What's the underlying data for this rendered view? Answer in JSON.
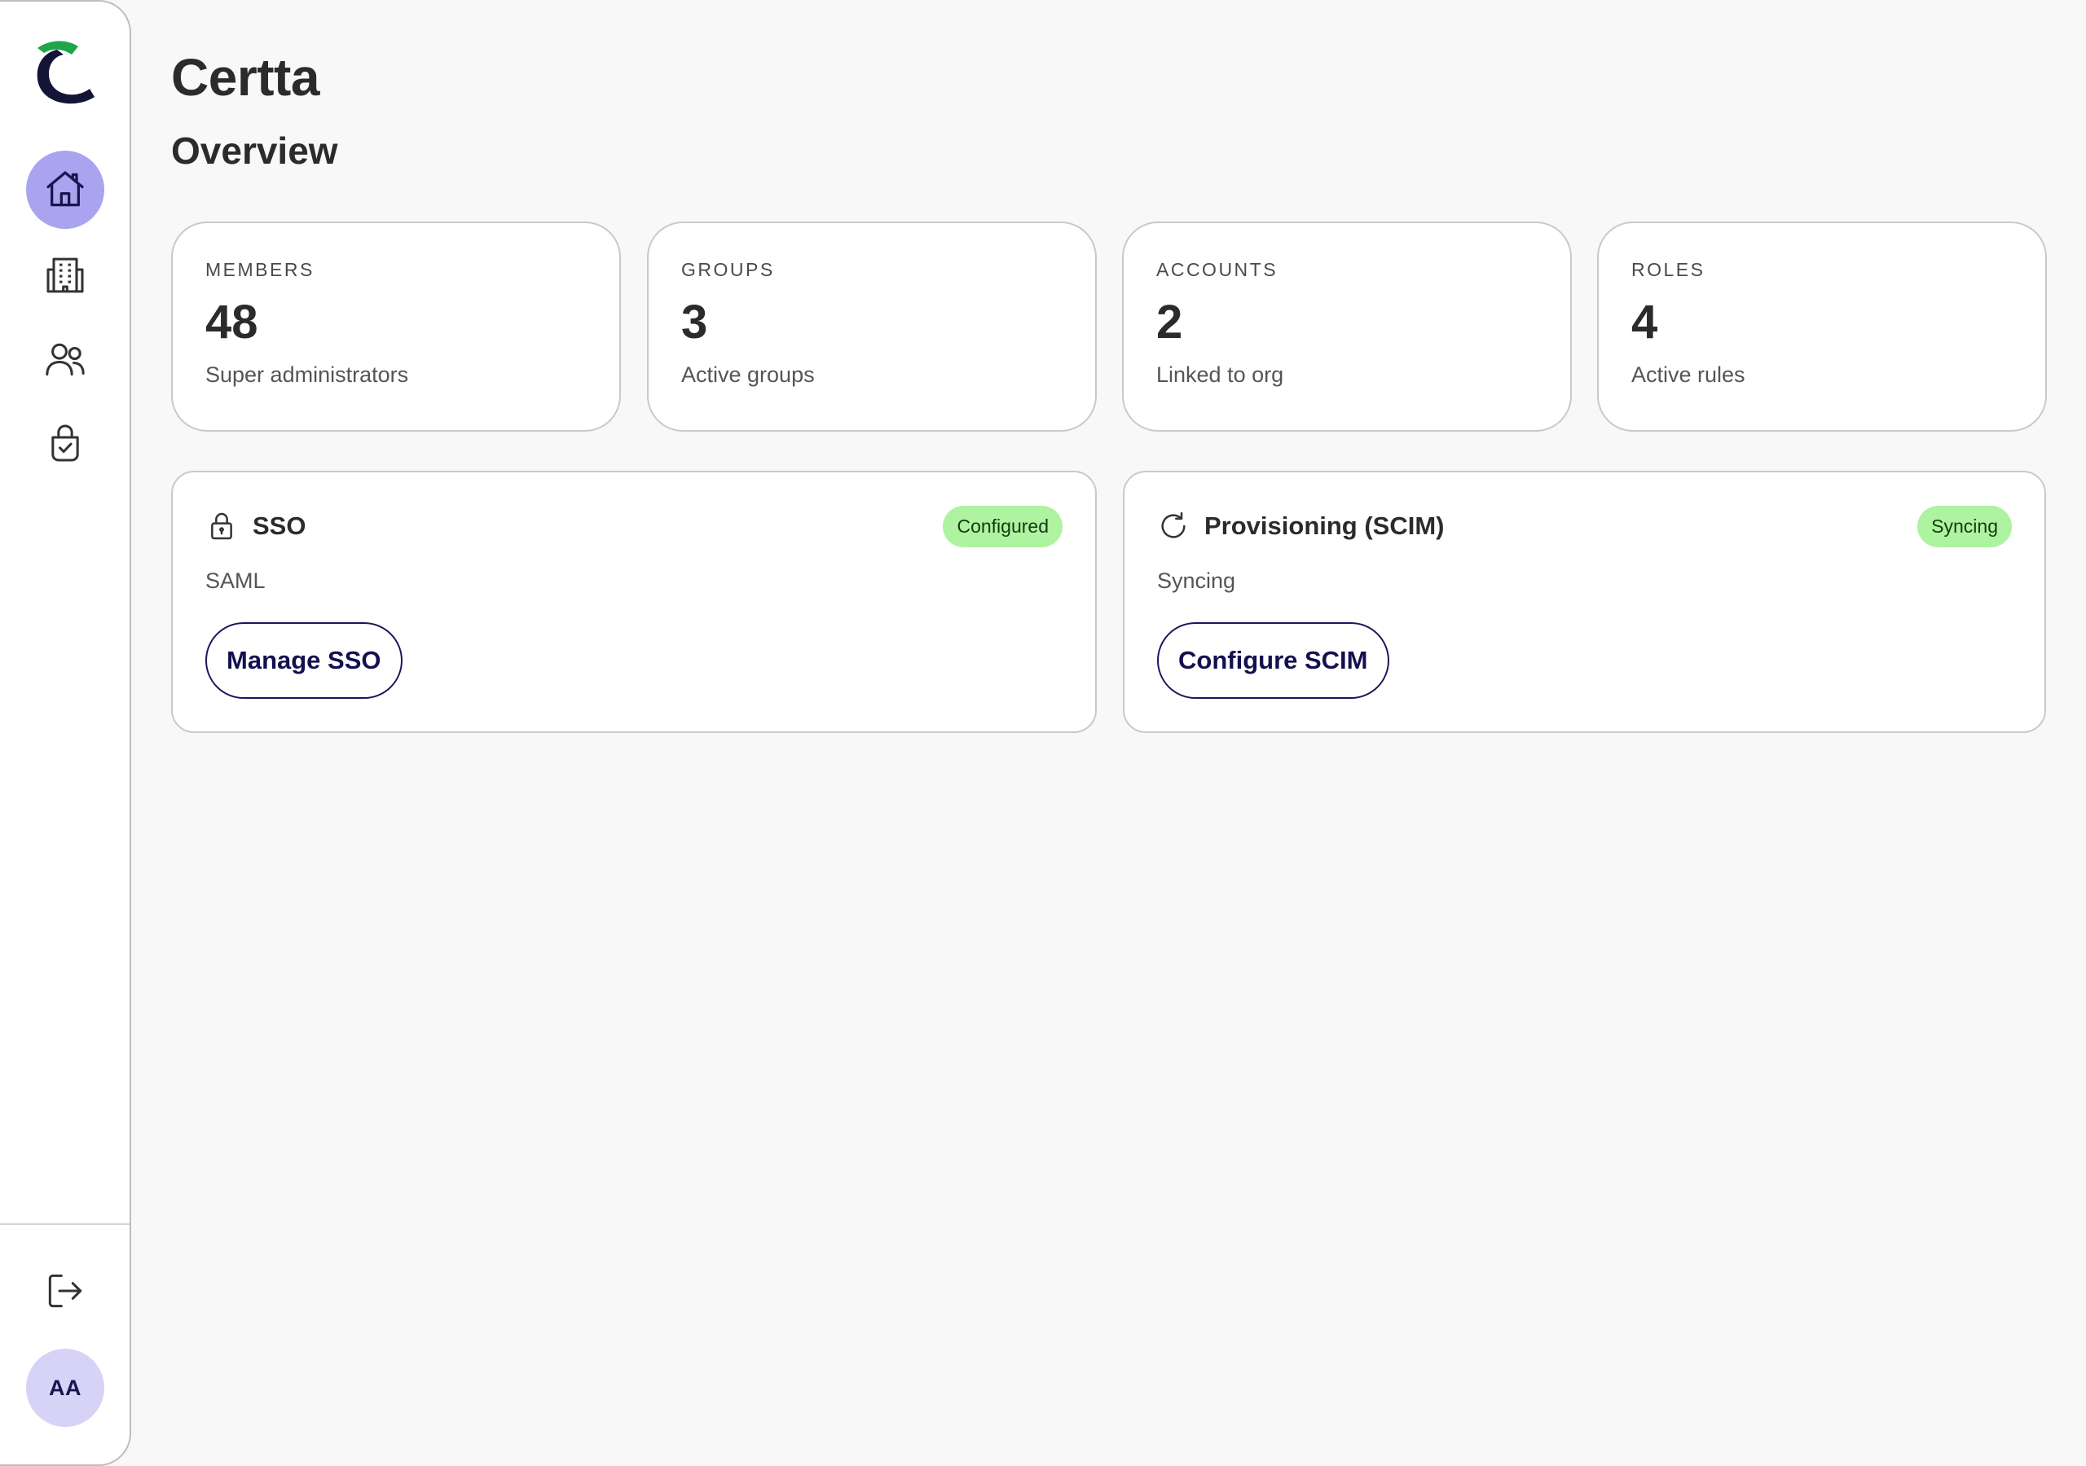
{
  "app": {
    "title": "Certta"
  },
  "page": {
    "title": "Overview"
  },
  "colors": {
    "accent": "#a9a3f0",
    "avatar_bg": "#d7d3f7",
    "badge_bg": "#aef3a0",
    "brand_green": "#1fa64a",
    "brand_navy": "#141437",
    "button_border": "#1b1660"
  },
  "sidebar": {
    "logo_icon": "certta-logo",
    "items": [
      {
        "icon": "home-icon",
        "active": true
      },
      {
        "icon": "building-icon",
        "active": false
      },
      {
        "icon": "users-icon",
        "active": false
      },
      {
        "icon": "shield-bag-icon",
        "active": false
      }
    ],
    "logout_icon": "logout-icon",
    "avatar_initials": "AA"
  },
  "stats": [
    {
      "label": "MEMBERS",
      "value": "48",
      "sub": "Super administrators"
    },
    {
      "label": "GROUPS",
      "value": "3",
      "sub": "Active groups"
    },
    {
      "label": "ACCOUNTS",
      "value": "2",
      "sub": "Linked to org"
    },
    {
      "label": "ROLES",
      "value": "4",
      "sub": "Active rules"
    }
  ],
  "sso": {
    "icon": "lock-icon",
    "title": "SSO",
    "badge": "Configured",
    "description": "SAML",
    "button": "Manage SSO"
  },
  "scim": {
    "icon": "refresh-icon",
    "title": "Provisioning (SCIM)",
    "badge": "Syncing",
    "description": "Syncing",
    "button": "Configure SCIM"
  }
}
